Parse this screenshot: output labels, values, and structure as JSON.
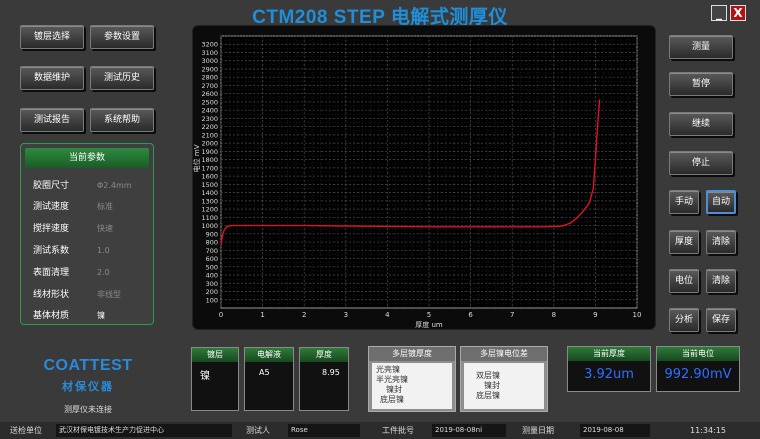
{
  "window": {
    "title": "CTM208 STEP 电解式测厚仪",
    "minimize": "_",
    "close": "X"
  },
  "left_buttons": [
    "镀层选择",
    "参数设置",
    "数据维护",
    "测试历史",
    "测试报告",
    "系统帮助"
  ],
  "params": {
    "title": "当前参数",
    "rows": [
      {
        "label": "胶圈尺寸",
        "value": "Φ2.4mm"
      },
      {
        "label": "测试速度",
        "value": "标准"
      },
      {
        "label": "搅拌速度",
        "value": "快速"
      },
      {
        "label": "测试系数",
        "value": "1.0"
      },
      {
        "label": "表面清理",
        "value": "2.0"
      },
      {
        "label": "线材形状",
        "value": "非线型"
      },
      {
        "label": "基体材质",
        "value": "镍"
      }
    ]
  },
  "logo": {
    "brand": "COATTEST",
    "sub": "材保仪器"
  },
  "status_text": "测厚仪未连接",
  "right_buttons": {
    "measure": "测量",
    "pause": "暂停",
    "continue": "继续",
    "stop": "停止",
    "manual": "手动",
    "auto": "自动",
    "thickness": "厚度",
    "clear1": "清除",
    "potential": "电位",
    "clear2": "清除",
    "analyze": "分析",
    "save": "保存"
  },
  "coating": {
    "header": "镀层",
    "value": "镍"
  },
  "electrolyte": {
    "header": "电解液",
    "value": "A5"
  },
  "thickness_col": {
    "header": "厚度",
    "value": "8.95"
  },
  "multi_thickness": {
    "header": "多层镀厚度",
    "items": [
      "光亮镍",
      "半光亮镍",
      "镍封",
      "底层镍"
    ]
  },
  "multi_potential": {
    "header": "多层镍电位差",
    "items": [
      "双层镍",
      "镍封",
      "底层镍"
    ]
  },
  "current_thickness": {
    "header": "当前厚度",
    "value": "3.92um"
  },
  "current_potential": {
    "header": "当前电位",
    "value": "992.90mV"
  },
  "statusbar": {
    "unit_label": "送检单位",
    "unit_value": "武汉材保电镀技术生产力促进中心",
    "tester_label": "测试人",
    "tester_value": "Rose",
    "batch_label": "工件批号",
    "batch_value": "2019-08-08ni",
    "date_label": "测量日期",
    "date_value": "2019-08-08",
    "time": "11:34:15"
  },
  "chart_data": {
    "type": "line",
    "xlabel": "厚度 um",
    "ylabel": "电位 mV",
    "xlim": [
      0,
      10
    ],
    "ylim": [
      0,
      3300
    ],
    "xticks": [
      0,
      1,
      2,
      3,
      4,
      5,
      6,
      7,
      8,
      9,
      10
    ],
    "yticks": [
      100,
      200,
      300,
      400,
      500,
      600,
      700,
      800,
      900,
      1000,
      1100,
      1200,
      1300,
      1400,
      1500,
      1600,
      1700,
      1800,
      1900,
      2000,
      2100,
      2200,
      2300,
      2400,
      2500,
      2600,
      2700,
      2800,
      2900,
      3000,
      3100,
      3200
    ],
    "grid": true,
    "line_color": "#e0102a",
    "series": [
      {
        "x": [
          0.0,
          0.03,
          0.08,
          0.15,
          0.25,
          1.0,
          2.0,
          3.0,
          4.0,
          5.0,
          6.0,
          7.0,
          7.8,
          8.2,
          8.4,
          8.55,
          8.7,
          8.85,
          8.95,
          9.0,
          9.05,
          9.1
        ],
        "y": [
          760,
          870,
          950,
          990,
          1000,
          1000,
          1000,
          995,
          990,
          985,
          985,
          985,
          985,
          995,
          1030,
          1090,
          1170,
          1270,
          1450,
          1800,
          2200,
          2530
        ]
      }
    ]
  }
}
